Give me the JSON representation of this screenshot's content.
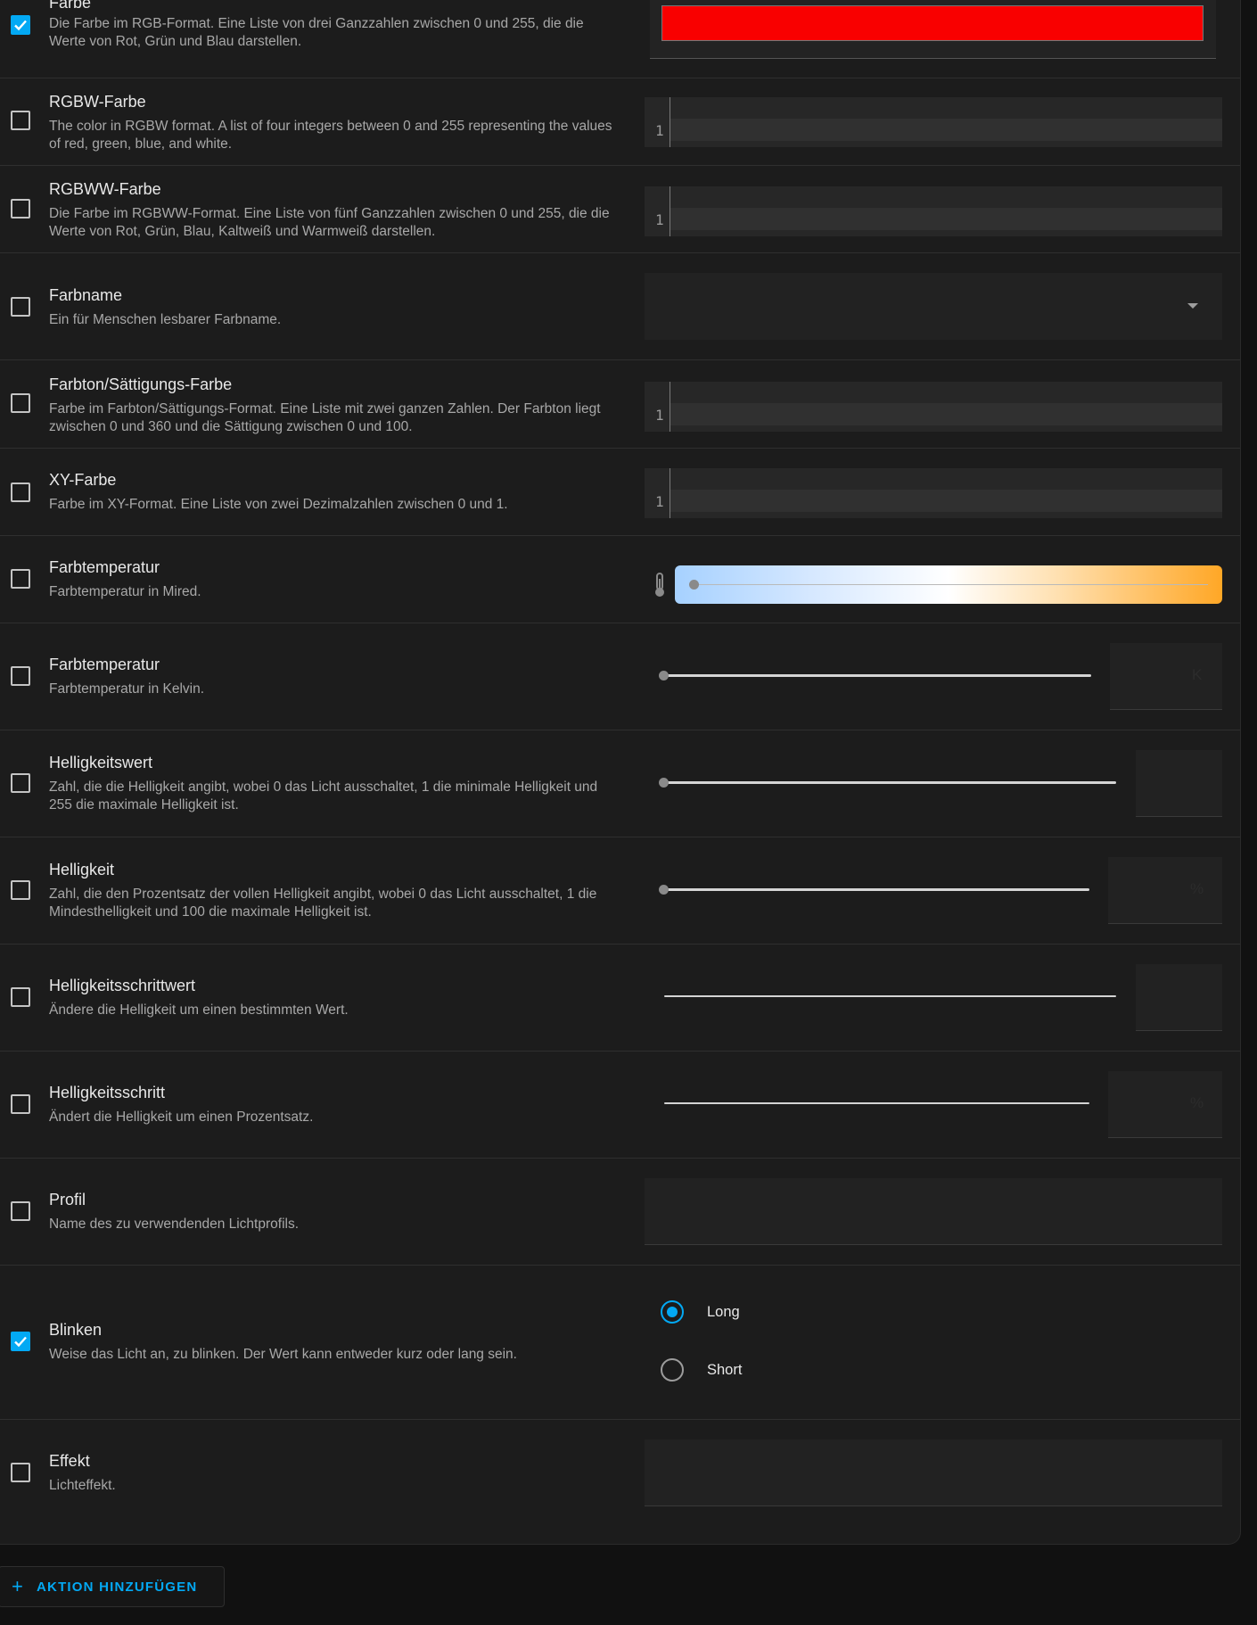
{
  "rows": {
    "farbe": {
      "title": "Farbe",
      "desc": "Die Farbe im RGB-Format. Eine Liste von drei Ganzzahlen zwischen 0 und 255, die die Werte von Rot, Grün und Blau darstellen.",
      "checked": true,
      "color": "#ff0000"
    },
    "rgbw": {
      "title": "RGBW-Farbe",
      "desc": "The color in RGBW format. A list of four integers between 0 and 255 representing the values of red, green, blue, and white.",
      "line": "1"
    },
    "rgbww": {
      "title": "RGBWW-Farbe",
      "desc": "Die Farbe im RGBWW-Format. Eine Liste von fünf Ganzzahlen zwischen 0 und 255, die die Werte von Rot, Grün, Blau, Kaltweiß und Warmweiß darstellen.",
      "line": "1"
    },
    "farbname": {
      "title": "Farbname",
      "desc": "Ein für Menschen lesbarer Farbname."
    },
    "hs": {
      "title": "Farbton/Sättigungs-Farbe",
      "desc": "Farbe im Farbton/Sättigungs-Format. Eine Liste mit zwei ganzen Zahlen. Der Farbton liegt zwischen 0 und 360 und die Sättigung zwischen 0 und 100.",
      "line": "1"
    },
    "xy": {
      "title": "XY-Farbe",
      "desc": "Farbe im XY-Format. Eine Liste von zwei Dezimalzahlen zwischen 0 und 1.",
      "line": "1"
    },
    "mired": {
      "title": "Farbtemperatur",
      "desc": "Farbtemperatur in Mired."
    },
    "kelvin": {
      "title": "Farbtemperatur",
      "desc": "Farbtemperatur in Kelvin.",
      "unit": "K"
    },
    "brightness_value": {
      "title": "Helligkeitswert",
      "desc": "Zahl, die die Helligkeit angibt, wobei 0 das Licht ausschaltet, 1 die minimale Helligkeit und 255 die maximale Helligkeit ist."
    },
    "brightness_pct": {
      "title": "Helligkeit",
      "desc": "Zahl, die den Prozentsatz der vollen Helligkeit angibt, wobei 0 das Licht ausschaltet, 1 die Mindesthelligkeit und 100 die maximale Helligkeit ist.",
      "unit": "%"
    },
    "brightness_step": {
      "title": "Helligkeitsschrittwert",
      "desc": "Ändere die Helligkeit um einen bestimmten Wert."
    },
    "brightness_step_pct": {
      "title": "Helligkeitsschritt",
      "desc": "Ändert die Helligkeit um einen Prozentsatz.",
      "unit": "%"
    },
    "profil": {
      "title": "Profil",
      "desc": "Name des zu verwendenden Lichtprofils."
    },
    "blinken": {
      "title": "Blinken",
      "desc": "Weise das Licht an, zu blinken. Der Wert kann entweder kurz oder lang sein.",
      "checked": true,
      "options": [
        "Long",
        "Short"
      ],
      "selected": "Long"
    },
    "effekt": {
      "title": "Effekt",
      "desc": "Lichteffekt."
    }
  },
  "add_action_label": "AKTION HINZUFÜGEN",
  "colors": {
    "accent": "#03a9f4",
    "card": "#1c1c1c",
    "background": "#111111"
  },
  "icons": {
    "thermometer": "thermometer-icon",
    "dropdown": "chevron-down-icon",
    "plus": "plus-icon",
    "check": "check-icon"
  }
}
